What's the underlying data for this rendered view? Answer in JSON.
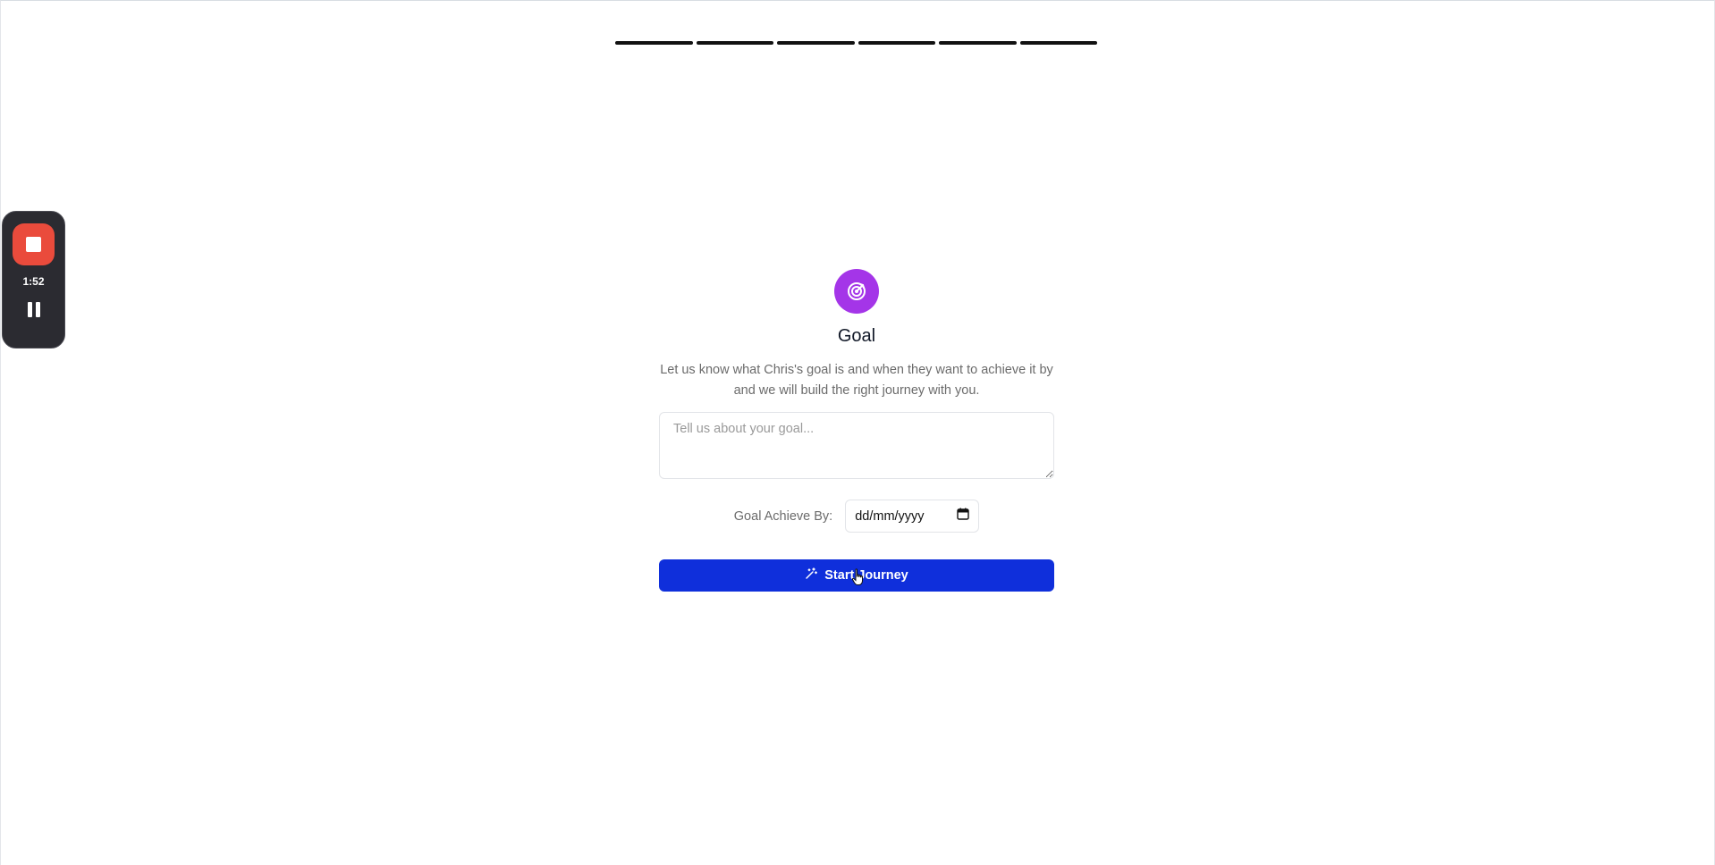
{
  "progress": {
    "segments_total": 6,
    "segments_complete": 6,
    "segment_color": "#111111"
  },
  "recorder": {
    "time": "1:52",
    "stop_icon": "stop-icon",
    "pause_icon": "pause-icon",
    "stop_color": "#ea4b3c"
  },
  "goal": {
    "icon": "target-icon",
    "icon_color": "#a435e8",
    "title": "Goal",
    "description": "Let us know what Chris's goal is and when they want to achieve it by and we will build the right journey with you.",
    "textarea_placeholder": "Tell us about your goal...",
    "textarea_value": "",
    "date_label": "Goal Achieve By:",
    "date_placeholder": "dd/mm/yyyy",
    "date_icon": "calendar-icon"
  },
  "actions": {
    "start_label": "Start Journey",
    "start_icon": "magic-wand-icon",
    "start_color": "#0f2fdb"
  }
}
